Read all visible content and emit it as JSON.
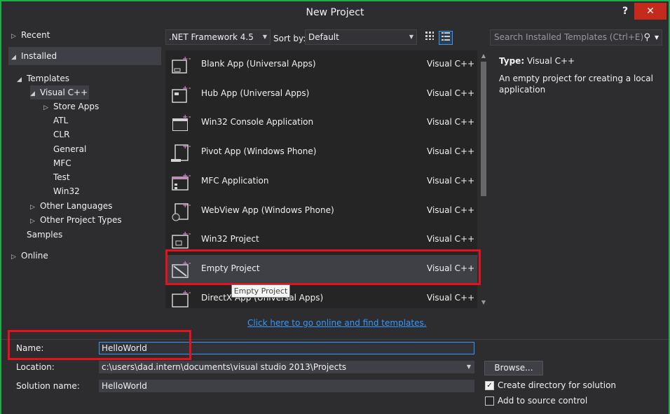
{
  "window": {
    "title": "New Project",
    "help_label": "?",
    "close_label": "✕",
    "border_color": "#1ead48"
  },
  "sidebar": {
    "recent": "Recent",
    "installed": "Installed",
    "templates": "Templates",
    "visual_cpp": "Visual C++",
    "children": [
      "Store Apps",
      "ATL",
      "CLR",
      "General",
      "MFC",
      "Test",
      "Win32"
    ],
    "other_languages": "Other Languages",
    "other_project_types": "Other Project Types",
    "samples": "Samples",
    "online": "Online"
  },
  "toolbar": {
    "framework": ".NET Framework 4.5",
    "sort_label": "Sort by:",
    "sort_value": "Default",
    "search_placeholder": "Search Installed Templates (Ctrl+E)"
  },
  "templates": [
    {
      "name": "Blank App (Universal Apps)",
      "lang": "Visual C++",
      "icon": "blank-app-icon"
    },
    {
      "name": "Hub App (Universal Apps)",
      "lang": "Visual C++",
      "icon": "hub-app-icon"
    },
    {
      "name": "Win32 Console Application",
      "lang": "Visual C++",
      "icon": "console-app-icon"
    },
    {
      "name": "Pivot App (Windows Phone)",
      "lang": "Visual C++",
      "icon": "pivot-app-icon"
    },
    {
      "name": "MFC Application",
      "lang": "Visual C++",
      "icon": "mfc-app-icon"
    },
    {
      "name": "WebView App (Windows Phone)",
      "lang": "Visual C++",
      "icon": "webview-app-icon"
    },
    {
      "name": "Win32 Project",
      "lang": "Visual C++",
      "icon": "win32-project-icon"
    },
    {
      "name": "Empty Project",
      "lang": "Visual C++",
      "icon": "empty-project-icon"
    },
    {
      "name": "DirectX App (Universal Apps)",
      "lang": "Visual C++",
      "icon": "directx-app-icon"
    }
  ],
  "tooltip": "Empty Project",
  "online_link": "Click here to go online and find templates.",
  "info": {
    "type_label": "Type:",
    "type_value": "Visual C++",
    "description": "An empty project for creating a local application"
  },
  "form": {
    "name_label": "Name:",
    "name_value": "HelloWorld",
    "location_label": "Location:",
    "location_value": "c:\\users\\dad.intern\\documents\\visual studio 2013\\Projects",
    "solution_label": "Solution name:",
    "solution_value": "HelloWorld",
    "browse_label": "Browse...",
    "create_dir_label": "Create directory for solution",
    "create_dir_checked": true,
    "source_control_label": "Add to source control",
    "source_control_checked": false
  },
  "colors": {
    "highlight": "#e5111c",
    "link": "#3399ff",
    "background": "#2d2d30"
  }
}
